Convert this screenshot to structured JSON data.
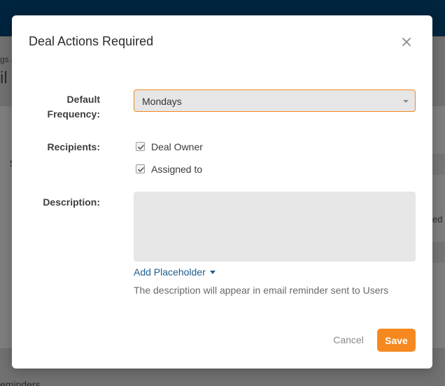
{
  "background": {
    "breadcrumb_fragment": "gs /",
    "heading_fragment": "il",
    "section_fragment": "S",
    "side_fragment": "ed t",
    "bottom_fragment": "eminders"
  },
  "modal": {
    "title": "Deal Actions Required",
    "close_icon": "close-icon",
    "frequency": {
      "label": "Default Frequency:",
      "value": "Mondays"
    },
    "recipients": {
      "label": "Recipients:",
      "options": [
        {
          "label": "Deal Owner",
          "checked": true
        },
        {
          "label": "Assigned to",
          "checked": true
        }
      ]
    },
    "description": {
      "label": "Description:",
      "value": "",
      "add_placeholder_label": "Add Placeholder",
      "helper": "The description will appear in email reminder sent to Users"
    },
    "actions": {
      "cancel_label": "Cancel",
      "save_label": "Save"
    }
  },
  "colors": {
    "accent": "#f5891f",
    "link": "#1b5d8f",
    "topbar": "#01243f"
  }
}
